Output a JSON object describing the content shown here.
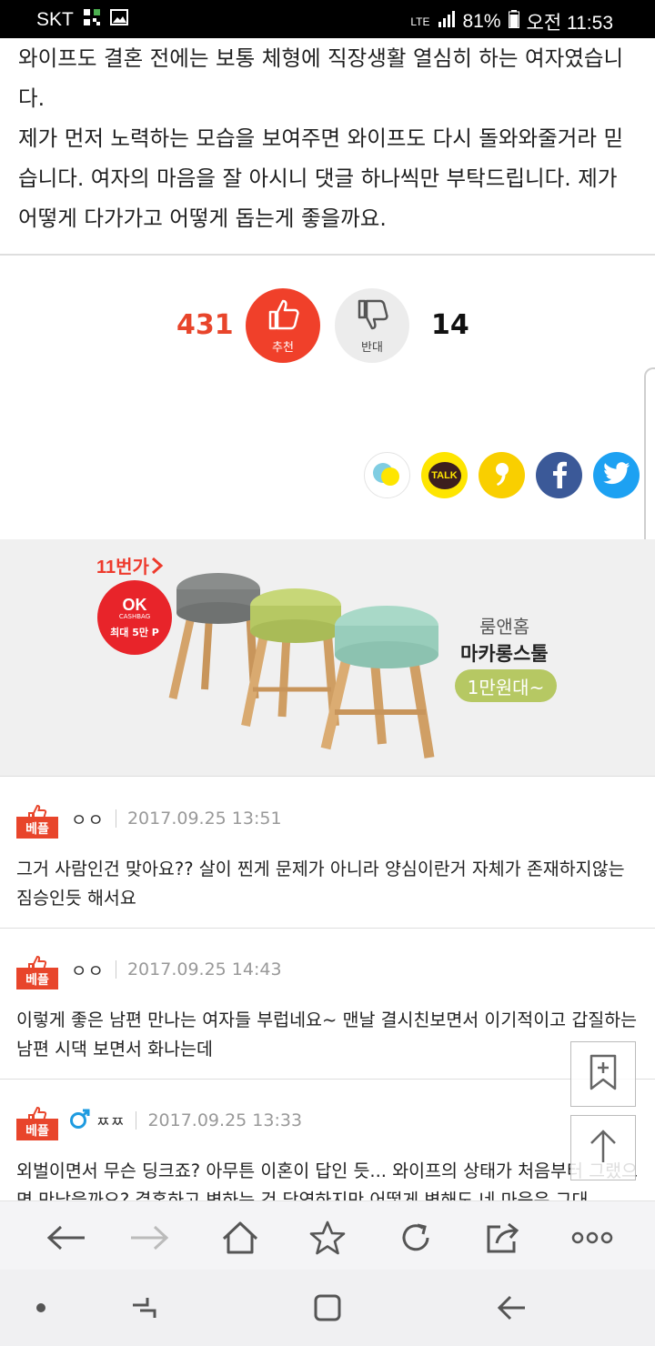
{
  "status_bar": {
    "carrier": "SKT",
    "network": "LTE",
    "battery": "81%",
    "time": "오전 11:53"
  },
  "article": {
    "paragraphs": [
      "와이프도 결혼 전에는 보통 체형에 직장생활 열심히 하는 여자였습니다.",
      "제가 먼저 노력하는 모습을 보여주면 와이프도 다시 돌와와줄거라 믿습니다. 여자의 마음을 잘 아시니 댓글 하나씩만 부탁드립니다. 제가 어떻게 다가가고 어떻게 돕는게 좋을까요."
    ]
  },
  "votes": {
    "up_count": "431",
    "up_label": "추천",
    "down_count": "14",
    "down_label": "반대"
  },
  "share": {
    "talk_label": "TALK"
  },
  "ad": {
    "brand": "11번가",
    "ok_title": "OK",
    "ok_sub": "CASHBAG",
    "ok_reward": "최대 5만 P",
    "shop": "룸앤홈",
    "product": "마카롱스툴",
    "price": "1만원대~"
  },
  "comments": [
    {
      "badge": "베플",
      "nick": "ㅇㅇ",
      "gender_icon": "",
      "date": "2017.09.25 13:51",
      "text": "그거 사람인건 맞아요?? 살이 찐게 문제가 아니라 양심이란거 자체가 존재하지않는 짐승인듯 해서요"
    },
    {
      "badge": "베플",
      "nick": "ㅇㅇ",
      "gender_icon": "",
      "date": "2017.09.25 14:43",
      "text": "이렇게 좋은 남편 만나는 여자들 부럽네요~ 맨날 결시친보면서 이기적이고 갑질하는 남편 시댁 보면서 화나는데"
    },
    {
      "badge": "베플",
      "nick": "ㅉㅉ",
      "gender_icon": "male",
      "date": "2017.09.25 13:33",
      "text": "외벌이면서 무슨 딩크죠? 아무튼 이혼이 답인 듯... 와이프의 상태가 처음부터 그랬으면 만났을까요? 결혼하고 변하는 건 당연하지만 어떻게 변해도 네 마음은 그대"
    }
  ],
  "colors": {
    "accent_red": "#f0402a",
    "badge_red": "#e8452b",
    "kakao_yellow": "#fee500",
    "facebook": "#3b5998",
    "twitter": "#1da1f2"
  }
}
